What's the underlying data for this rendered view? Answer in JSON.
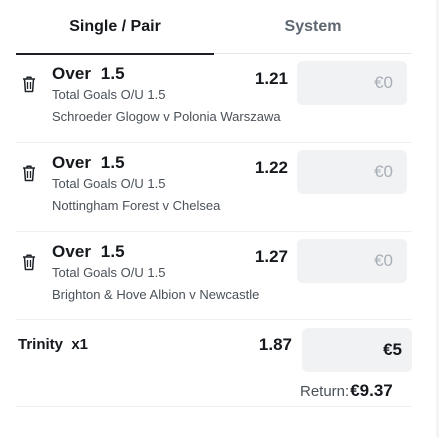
{
  "tabs": [
    {
      "label": "Single / Pair",
      "active": true
    },
    {
      "label": "System",
      "active": false
    }
  ],
  "bets": [
    {
      "selection": "Over  1.5",
      "market": "Total Goals O/U 1.5",
      "event": "Schroeder Glogow v Polonia Warszawa",
      "odds": "1.21",
      "stake_placeholder": "€0"
    },
    {
      "selection": "Over  1.5",
      "market": "Total Goals O/U 1.5",
      "event": "Nottingham Forest v Chelsea",
      "odds": "1.22",
      "stake_placeholder": "€0"
    },
    {
      "selection": "Over  1.5",
      "market": "Total Goals O/U 1.5",
      "event": "Brighton & Hove Albion v Newcastle",
      "odds": "1.27",
      "stake_placeholder": "€0"
    }
  ],
  "trinity": {
    "label": "Trinity  x1",
    "odds": "1.87",
    "stake": "€5"
  },
  "summary": {
    "return_label": "Return:",
    "return_value": "€9.37"
  },
  "icons": {
    "delete": "trash-icon"
  },
  "colors": {
    "text": "#15181c",
    "muted": "#4a5159",
    "input_bg": "#f1f2f4",
    "placeholder": "#a9afb6"
  }
}
